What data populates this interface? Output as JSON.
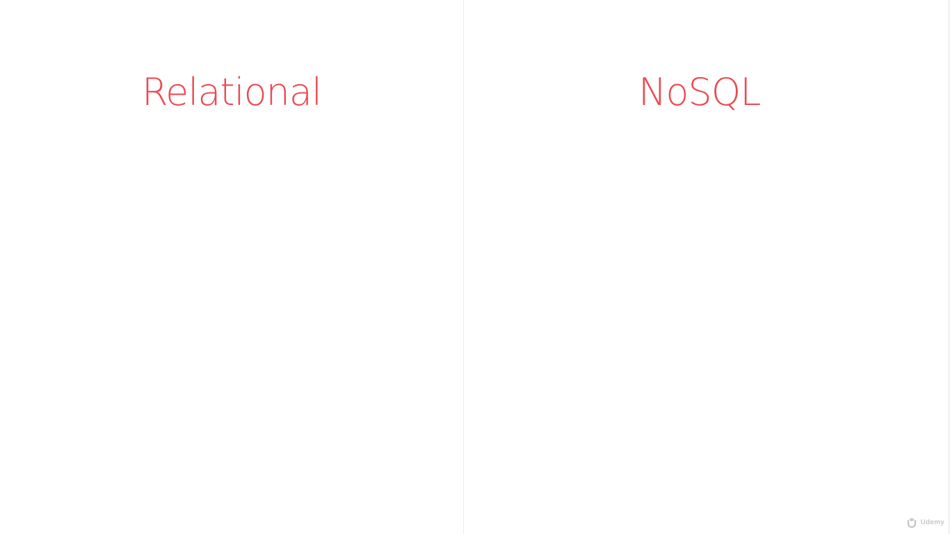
{
  "slide": {
    "left_heading": "Relational",
    "right_heading": "NoSQL"
  },
  "watermark": {
    "text": "Udemy",
    "icon": "udemy-logo-icon"
  },
  "colors": {
    "heading": "#ec4a52",
    "background": "#ffffff",
    "divider": "#ececec"
  }
}
